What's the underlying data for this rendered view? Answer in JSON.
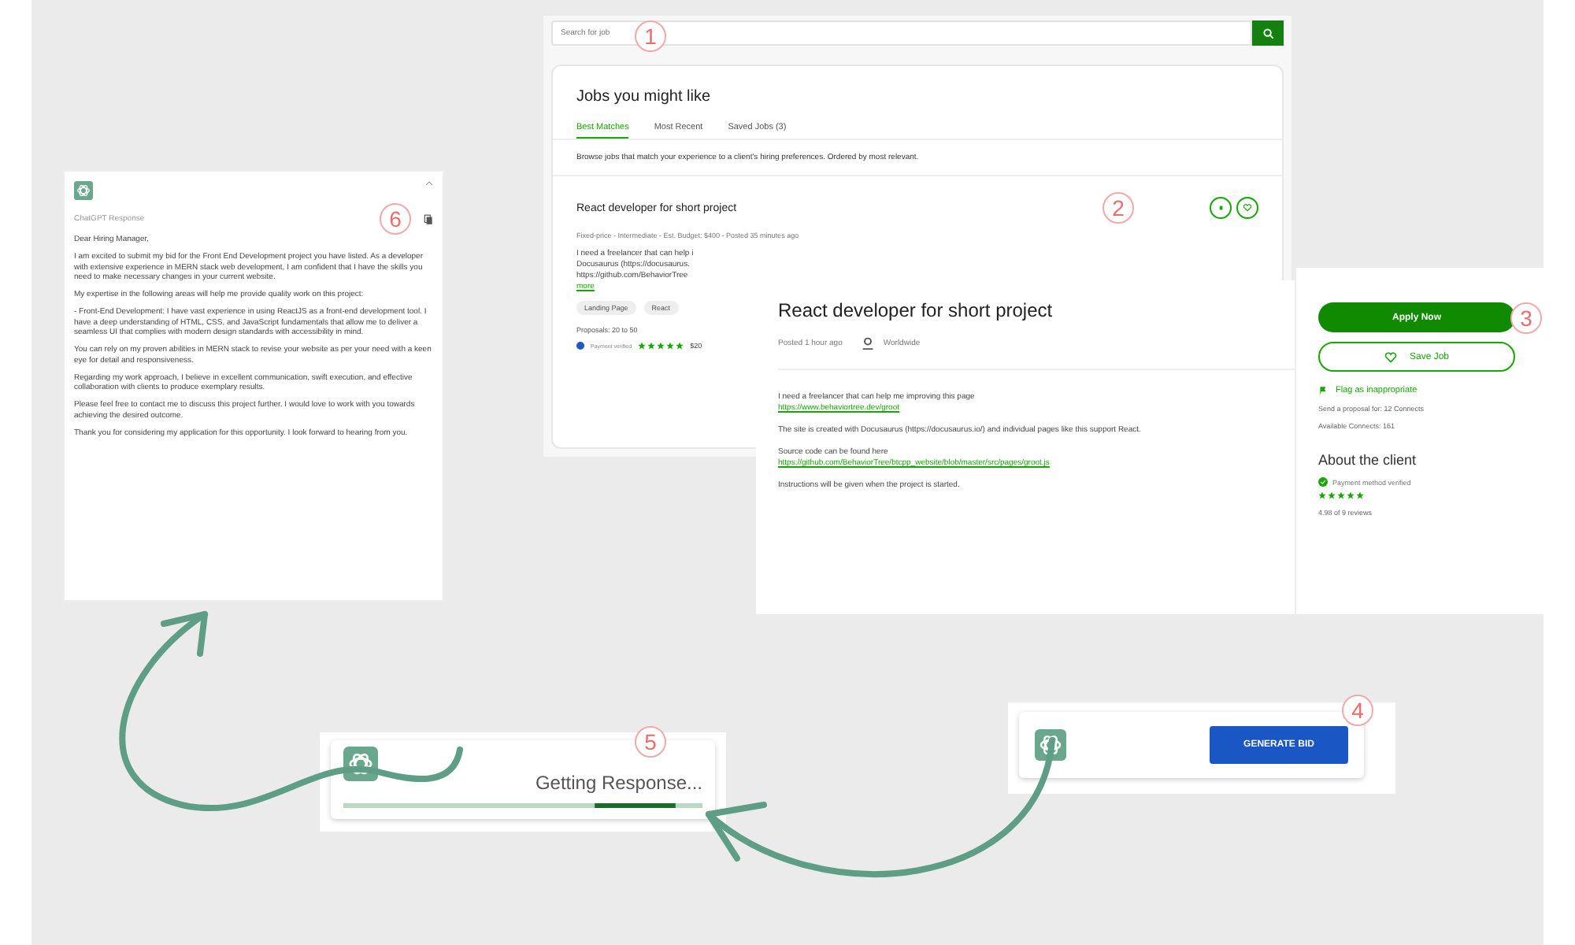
{
  "search_panel": {
    "placeholder": "Search for job",
    "badge": "1"
  },
  "jobs_card": {
    "title": "Jobs you might like",
    "tabs": [
      {
        "label": "Best Matches",
        "selected": true
      },
      {
        "label": "Most Recent",
        "selected": false
      },
      {
        "label": "Saved Jobs (3)",
        "selected": false
      }
    ],
    "intro": "Browse jobs that match your experience to a client's hiring preferences. Ordered by most relevant.",
    "job": {
      "title": "React developer for short project",
      "badge": "2",
      "meta": "Fixed-price - Intermediate - Est. Budget: $400 - Posted 35 minutes ago",
      "excerpt": [
        "I need a freelancer that can help i",
        "Docusaurus (https://docusaurus.",
        "https://github.com/BehaviorTree"
      ],
      "more": "more",
      "tags": [
        "Landing Page",
        "React"
      ],
      "proposals": "Proposals: 20 to 50",
      "payment": "Payment verified",
      "stars": 5,
      "spent": "$20"
    }
  },
  "job_detail": {
    "title": "React developer for short project",
    "posted": "Posted 1 hour ago",
    "location": "Worldwide",
    "paragraphs": [
      {
        "text": "I need a freelancer that can help me improving this page",
        "link": "https://www.behaviortree.dev/groot"
      },
      {
        "text": "The site is created with Docusaurus (https://docusaurus.io/) and individual pages like this support React."
      },
      {
        "text": "Source code can be found here",
        "link": "https://github.com/BehaviorTree/btcpp_website/blob/master/src/pages/groot.js"
      },
      {
        "text": "Instructions will be given when the project is started."
      }
    ]
  },
  "sidebar": {
    "apply": "Apply Now",
    "badge": "3",
    "save": "Save Job",
    "flag": "Flag as inappropriate",
    "connects": "Send a proposal for: 12 Connects",
    "available": "Available Connects: 161",
    "about": "About the client",
    "payment": "Payment method verified",
    "stars": 5,
    "reviews": "4.98 of 9 reviews"
  },
  "generate_card": {
    "button": "GENERATE BID",
    "badge": "4"
  },
  "loading_card": {
    "text": "Getting Response...",
    "badge": "5"
  },
  "response_panel": {
    "label": "ChatGPT Response",
    "badge": "6",
    "paragraphs": [
      "Dear Hiring Manager,",
      "I am excited to submit my bid for the Front End Development project you have listed. As a developer with extensive experience in MERN stack web development, I am confident that I have the skills you need to make necessary changes in your current website.",
      "My expertise in the following areas will help me provide quality work on this project:",
      "- Front-End Development: I have vast experience in using ReactJS as a front-end development tool. I have a deep understanding of HTML, CSS, and JavaScript fundamentals that allow me to deliver a seamless UI that complies with modern design standards with accessibility in mind.",
      "You can rely on my proven abilities in MERN stack to revise your website as per your need with a keen eye for detail and responsiveness.",
      "Regarding my work approach, I believe in excellent communication, swift execution, and effective collaboration with clients to produce exemplary results.",
      "Please feel free to contact me to discuss this project further. I would love to work with you towards achieving the desired outcome.",
      "Thank you for considering my application for this opportunity. I look forward to hearing from you."
    ]
  }
}
